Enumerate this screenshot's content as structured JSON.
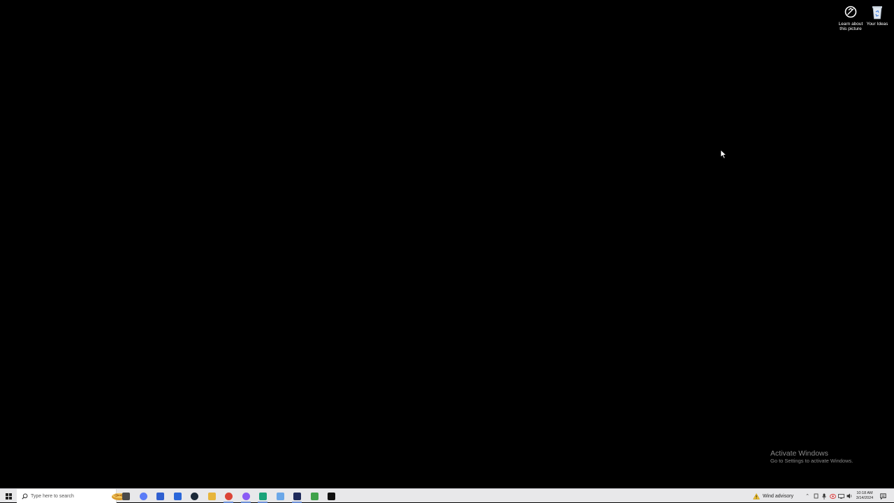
{
  "desktop": {
    "background_color": "#000000",
    "icons": [
      {
        "id": "learn",
        "label": "Learn about this picture",
        "icon": "info-circle-icon"
      },
      {
        "id": "ideas",
        "label": "Your Ideas",
        "icon": "recycle-bin-icon"
      }
    ]
  },
  "watermark": {
    "title": "Activate Windows",
    "subtitle": "Go to Settings to activate Windows."
  },
  "taskbar": {
    "start_icon": "windows-start-icon",
    "search_placeholder": "Type here to search",
    "pinned_apps": [
      {
        "name": "task-view",
        "icon": "task-view-icon",
        "color": "#4a4a4a",
        "running": false
      },
      {
        "name": "copilot",
        "icon": "copilot-icon",
        "color": "#5b7cf7",
        "running": false
      },
      {
        "name": "blue-app",
        "icon": "blue-app-icon",
        "color": "#2f5fd0",
        "running": false
      },
      {
        "name": "meta",
        "icon": "meta-icon",
        "color": "#2a66d9",
        "running": false
      },
      {
        "name": "steam",
        "icon": "steam-icon",
        "color": "#1b2838",
        "running": false
      },
      {
        "name": "file-explorer",
        "icon": "folder-icon",
        "color": "#e7b53b",
        "running": false
      },
      {
        "name": "chrome",
        "icon": "chrome-icon",
        "color": "#db4437",
        "running": true
      },
      {
        "name": "messenger",
        "icon": "messenger-icon",
        "color": "#8a5cf5",
        "running": true
      },
      {
        "name": "android-app",
        "icon": "android-icon",
        "color": "#1aa37a",
        "running": true
      },
      {
        "name": "diamond-app",
        "icon": "diamond-icon",
        "color": "#6aa7e8",
        "running": false
      },
      {
        "name": "terminal-app",
        "icon": "terminal-icon",
        "color": "#1e2a5a",
        "running": true
      },
      {
        "name": "minecraft",
        "icon": "minecraft-icon",
        "color": "#3fa24a",
        "running": false
      },
      {
        "name": "tiktok",
        "icon": "tiktok-icon",
        "color": "#111111",
        "running": false
      }
    ],
    "weather": {
      "text": "Wind advisory",
      "icon": "warning-icon"
    },
    "tray_icons": [
      "chevron-up-icon",
      "usb-icon",
      "mic-icon",
      "nvidia-icon",
      "network-icon",
      "volume-icon"
    ],
    "clock": {
      "time": "10:18 AM",
      "date": "3/14/2024"
    }
  }
}
